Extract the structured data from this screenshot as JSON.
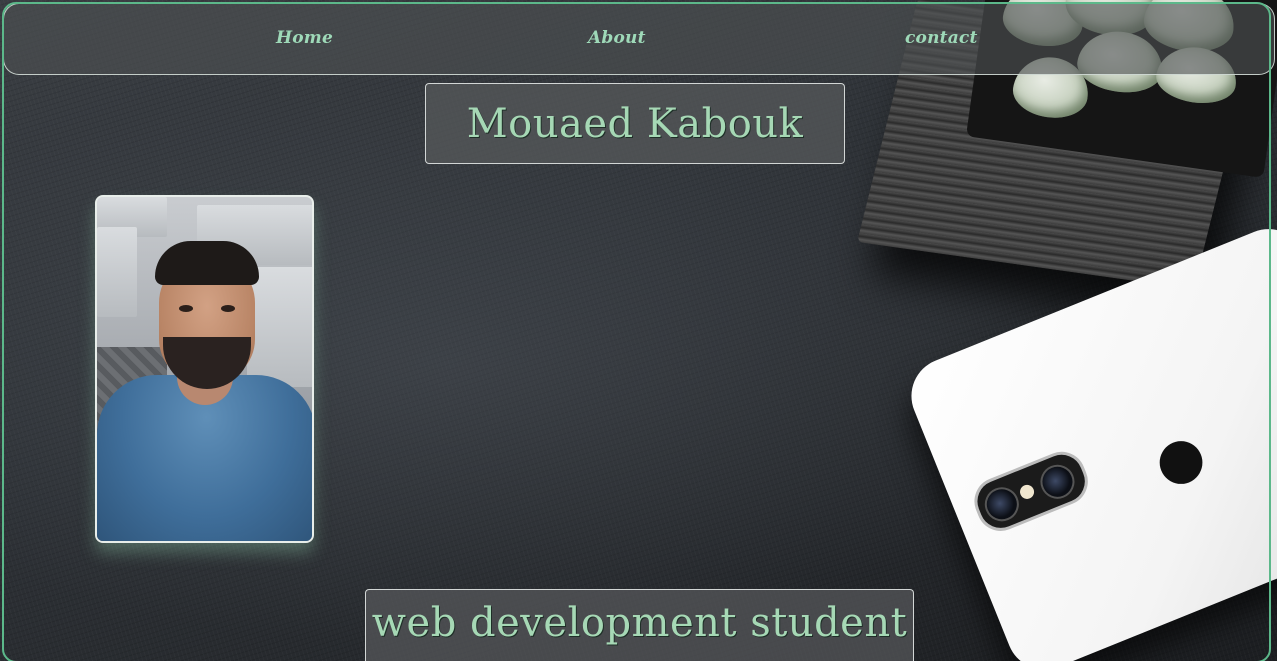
{
  "nav": {
    "links": [
      {
        "label": "Home"
      },
      {
        "label": "About"
      },
      {
        "label": "contact"
      }
    ]
  },
  "hero": {
    "name": "Mouaed Kabouk",
    "subtitle": "web development student"
  },
  "photo": {
    "alt": "Profile photo of Mouaed Kabouk"
  },
  "colors": {
    "accent": "#a6d8b5",
    "nav_link": "#9ed9b8",
    "frame_border": "#5cb88a"
  },
  "icons": {
    "apple": "apple-logo-icon"
  }
}
